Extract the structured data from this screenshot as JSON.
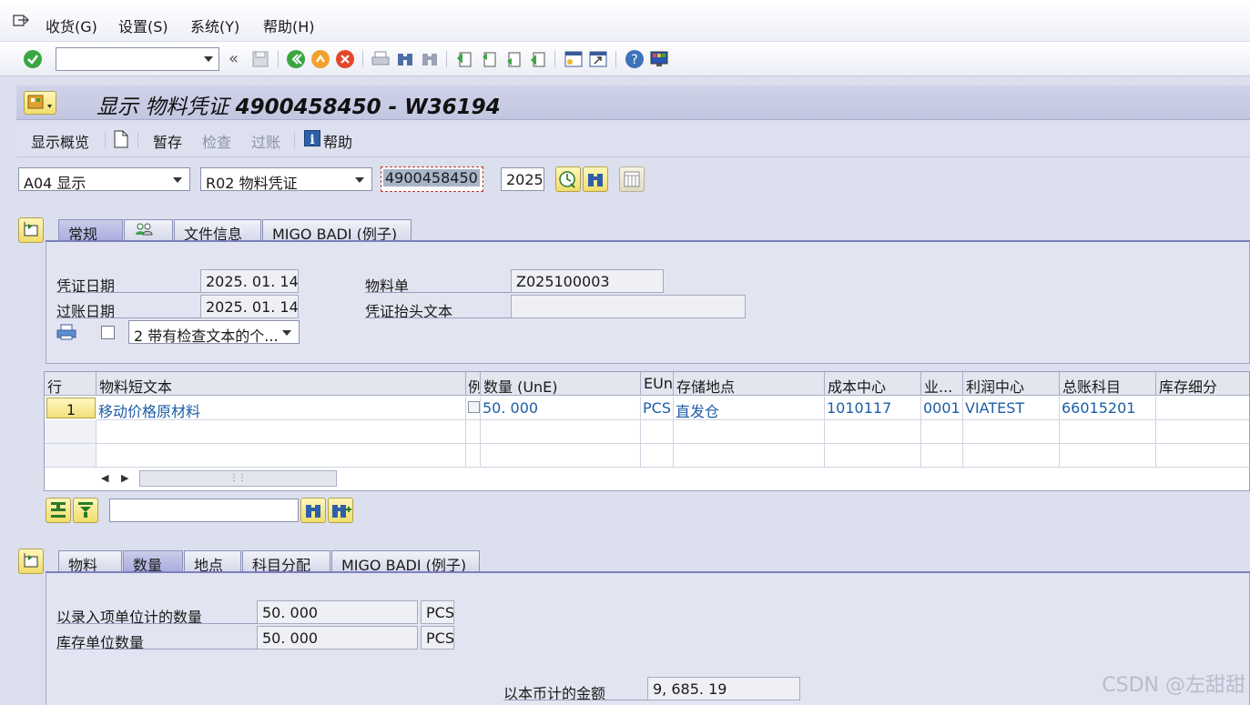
{
  "menubar": {
    "items": [
      {
        "label": "收货(G)"
      },
      {
        "label": "设置(S)"
      },
      {
        "label": "系统(Y)"
      },
      {
        "label": "帮助(H)"
      }
    ]
  },
  "toolbar": {
    "command_value": ""
  },
  "title": {
    "prefix": "显示 物料凭证 ",
    "doc": "4900458450 - W36194"
  },
  "app_toolbar": {
    "overview": "显示概览",
    "save": "暂存",
    "check": "检查",
    "post": "过账",
    "help": "帮助"
  },
  "selection": {
    "action": "A04 显示",
    "reference": "R02 物料凭证",
    "doc_number": "4900458450",
    "year": "2025"
  },
  "header_tabs": [
    {
      "label": "常规",
      "active": true
    },
    {
      "label": "",
      "icon": "people-icon"
    },
    {
      "label": "文件信息"
    },
    {
      "label": "MIGO BADI (例子)"
    }
  ],
  "header": {
    "doc_date_label": "凭证日期",
    "doc_date": "2025. 01. 14",
    "post_date_label": "过账日期",
    "post_date": "2025. 01. 14",
    "material_slip_label": "物料单",
    "material_slip": "Z025100003",
    "header_text_label": "凭证抬头文本",
    "header_text": "",
    "print_option": "2 带有检查文本的个..."
  },
  "items_grid": {
    "columns": [
      "行",
      "物料短文本",
      "例",
      "数量 (UnE)",
      "EUn",
      "存储地点",
      "成本中心",
      "业...",
      "利润中心",
      "总账科目",
      "库存细分"
    ],
    "rows": [
      [
        "1",
        "移动价格原材料",
        "",
        "50. 000",
        "PCS",
        "直发仓",
        "1010117",
        "0001",
        "VIATEST",
        "66015201",
        ""
      ]
    ]
  },
  "detail_tabs": [
    {
      "label": "物料"
    },
    {
      "label": "数量",
      "active": true
    },
    {
      "label": "地点"
    },
    {
      "label": "科目分配"
    },
    {
      "label": "MIGO BADI (例子)"
    }
  ],
  "quantity": {
    "entry_label": "以录入项单位计的数量",
    "entry_qty": "50. 000",
    "entry_unit": "PCS",
    "stock_label": "库存单位数量",
    "stock_qty": "50. 000",
    "stock_unit": "PCS",
    "amount_label": "以本币计的金额",
    "amount": "9, 685. 19"
  },
  "watermark": "CSDN @左甜甜",
  "colors": {
    "accent": "#7b7fbd",
    "link": "#1c5da8",
    "button_yellow": "#f2e07a"
  }
}
